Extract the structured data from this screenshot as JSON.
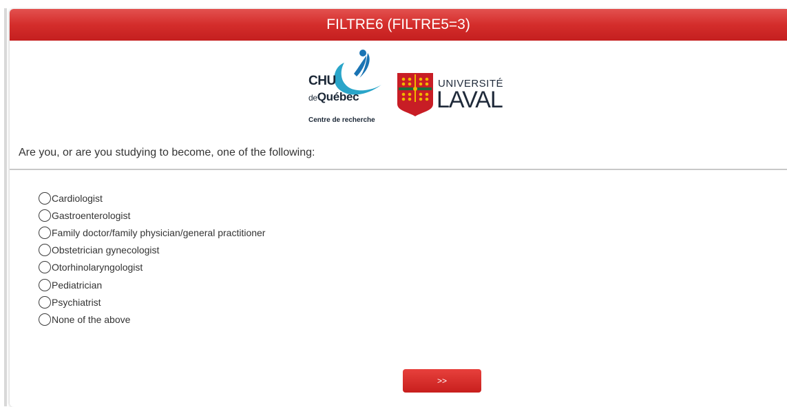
{
  "header": {
    "title": "FILTRE6 (FILTRE5=3)"
  },
  "logos": {
    "chu": {
      "line1": "CHU",
      "line2_prefix": "de",
      "line2": "Québec",
      "line3": "Centre de recherche"
    },
    "laval": {
      "line1": "UNIVERSITÉ",
      "line2": "LAVAL"
    }
  },
  "question": {
    "text": "Are you, or are you studying to become, one of the following:"
  },
  "options": [
    "Cardiologist",
    "Gastroenterologist",
    "Family doctor/family physician/general practitioner",
    "Obstetrician gynecologist",
    "Otorhinolaryngologist",
    "Pediatrician",
    "Psychiatrist",
    "None of the above"
  ],
  "footer": {
    "next_label": ">>"
  },
  "colors": {
    "header_red": "#d42d2b",
    "button_red": "#d42d2b",
    "text": "#333333"
  }
}
